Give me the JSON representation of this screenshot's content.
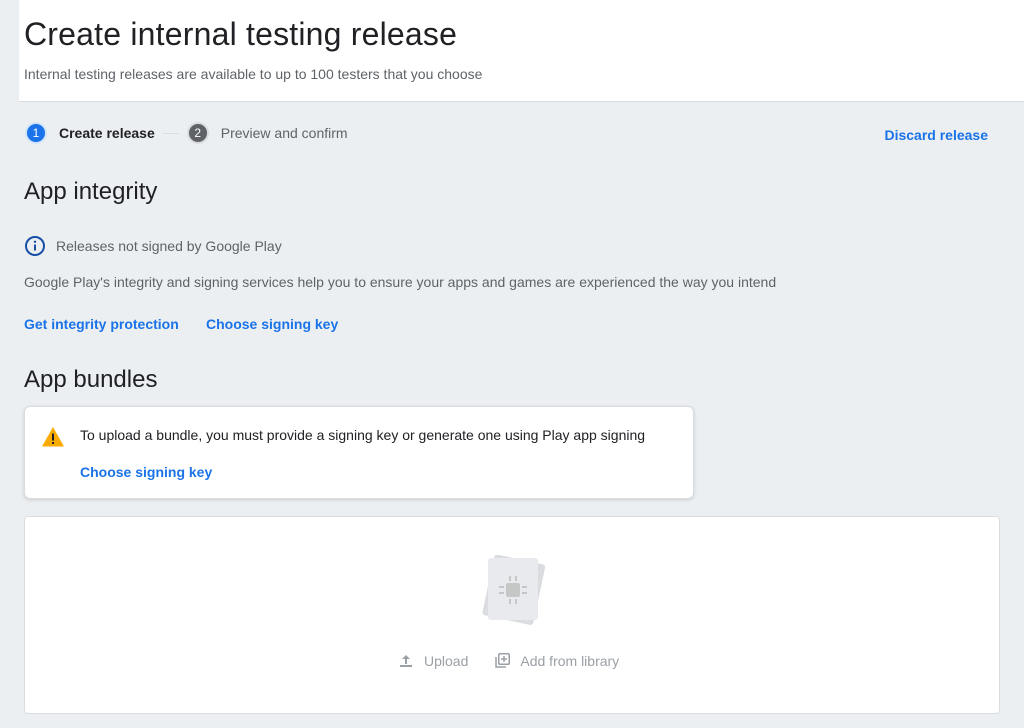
{
  "header": {
    "title": "Create internal testing release",
    "subtitle": "Internal testing releases are available to up to 100 testers that you choose"
  },
  "stepper": {
    "steps": [
      {
        "number": "1",
        "label": "Create release"
      },
      {
        "number": "2",
        "label": "Preview and confirm"
      }
    ],
    "active_step": 1
  },
  "discard_label": "Discard release",
  "app_integrity": {
    "title": "App integrity",
    "status_icon": "info-icon",
    "status_text": "Releases not signed by Google Play",
    "description": "Google Play's integrity and signing services help you to ensure your apps and games are experienced the way you intend",
    "links": {
      "integrity": "Get integrity protection",
      "signing_key": "Choose signing key"
    }
  },
  "app_bundles": {
    "title": "App bundles",
    "warning": {
      "icon": "warning-icon",
      "text": "To upload a bundle, you must provide a signing key or generate one using Play app signing",
      "link": "Choose signing key"
    },
    "upload": {
      "upload_label": "Upload",
      "library_label": "Add from library"
    }
  },
  "colors": {
    "accent": "#1a73e8",
    "warning": "#f9ab00",
    "disabled": "#9aa0a6"
  }
}
